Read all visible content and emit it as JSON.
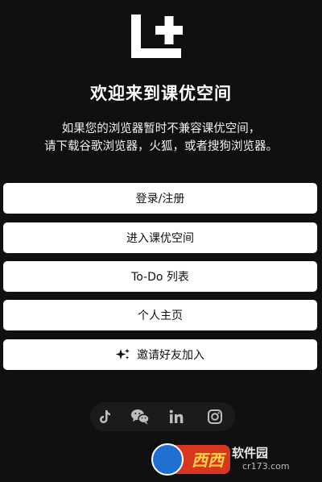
{
  "app": {
    "welcome_title": "欢迎来到课优空间",
    "notice_line1": "如果您的浏览器暂时不兼容课优空间，",
    "notice_line2": "请下载谷歌浏览器，火狐，或者搜狗浏览器。"
  },
  "menu": [
    {
      "label": "登录/注册"
    },
    {
      "label": "进入课优空间"
    },
    {
      "label": "To-Do 列表"
    },
    {
      "label": "个人主页"
    },
    {
      "label": "邀请好友加入",
      "icon": "sparkle-icon"
    }
  ],
  "social": [
    {
      "icon": "tiktok-icon"
    },
    {
      "icon": "wechat-icon"
    },
    {
      "icon": "linkedin-icon"
    },
    {
      "icon": "instagram-icon"
    }
  ],
  "watermark": {
    "brand": "软件园",
    "domain": "cr173.com",
    "mark": "西西"
  },
  "colors": {
    "background": "#101010",
    "button": "#ffffff",
    "button_text": "#111111",
    "social_bar": "#1b1b1b"
  }
}
